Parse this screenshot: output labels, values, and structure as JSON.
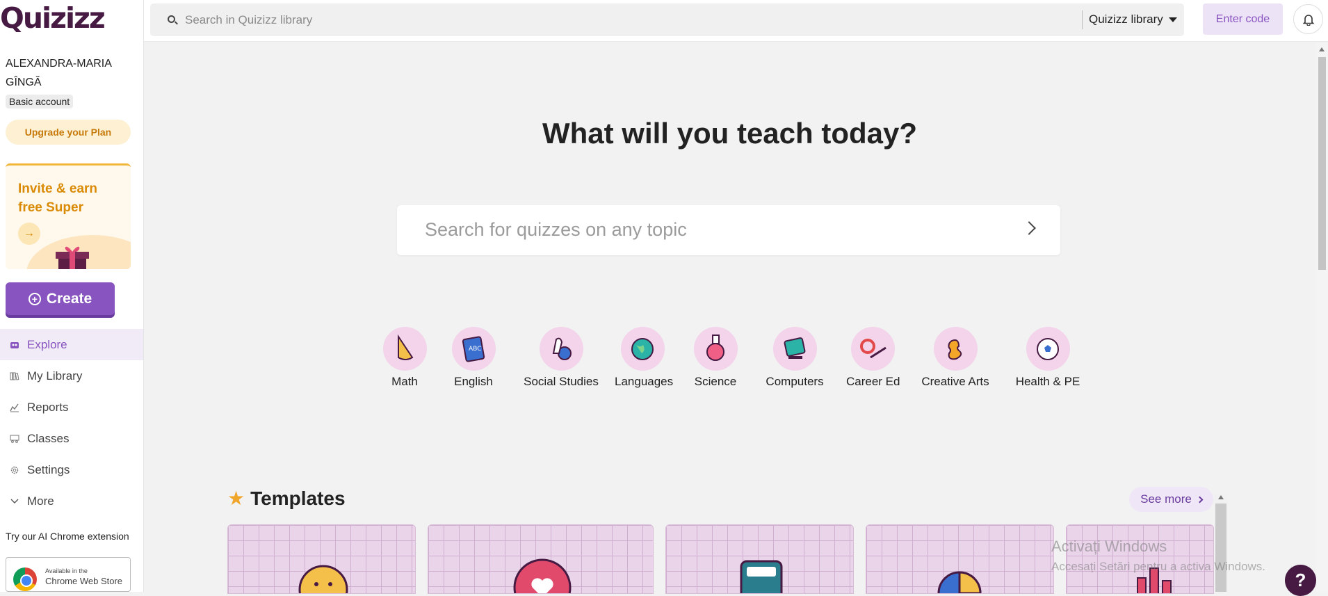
{
  "app": {
    "logo_text": "Quizizz"
  },
  "sidebar": {
    "user_name": "ALEXANDRA-MARIA GÎNGĂ",
    "account_type": "Basic account",
    "upgrade_label": "Upgrade your Plan",
    "invite_text": "Invite & earn free Super",
    "create_label": "Create",
    "nav": [
      {
        "label": "Explore",
        "icon": "explore-icon",
        "active": true
      },
      {
        "label": "My Library",
        "icon": "library-icon"
      },
      {
        "label": "Reports",
        "icon": "reports-icon"
      },
      {
        "label": "Classes",
        "icon": "classes-icon"
      },
      {
        "label": "Settings",
        "icon": "settings-icon"
      },
      {
        "label": "More",
        "icon": "chevron-down-icon"
      }
    ],
    "chrome_extension_text": "Try our AI Chrome extension",
    "chrome_badge_small": "Available in the",
    "chrome_badge_big": "Chrome Web Store"
  },
  "topbar": {
    "search_placeholder": "Search in Quizizz library",
    "library_select": "Quizizz library",
    "enter_code_label": "Enter code"
  },
  "main": {
    "title": "What will you teach today?",
    "topic_search_placeholder": "Search for quizzes on any topic",
    "subjects": [
      {
        "label": "Math",
        "icon": "math-cone-icon"
      },
      {
        "label": "English",
        "icon": "english-book-icon"
      },
      {
        "label": "Social Studies",
        "icon": "social-studies-icon"
      },
      {
        "label": "Languages",
        "icon": "globe-icon"
      },
      {
        "label": "Science",
        "icon": "flask-icon"
      },
      {
        "label": "Computers",
        "icon": "computer-icon"
      },
      {
        "label": "Career Ed",
        "icon": "career-icon"
      },
      {
        "label": "Creative Arts",
        "icon": "creative-arts-icon"
      },
      {
        "label": "Health & PE",
        "icon": "soccer-ball-icon"
      }
    ],
    "templates_title": "Templates",
    "see_more_label": "See more"
  },
  "watermark": {
    "line1": "Activați Windows",
    "line2": "Accesați Setări pentru a activa Windows."
  },
  "help_label": "?"
}
